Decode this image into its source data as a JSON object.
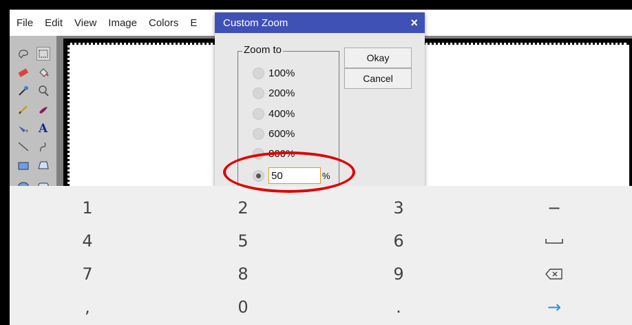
{
  "menu": [
    "File",
    "Edit",
    "View",
    "Image",
    "Colors",
    "E"
  ],
  "dialog": {
    "title": "Custom Zoom",
    "close": "×",
    "group_label": "Zoom to",
    "options": [
      "100%",
      "200%",
      "400%",
      "600%",
      "800%"
    ],
    "custom_value": "50",
    "custom_unit": "%",
    "ok_label": "Okay",
    "cancel_label": "Cancel"
  },
  "keyboard": {
    "rows": [
      [
        "1",
        "2",
        "3",
        "−"
      ],
      [
        "4",
        "5",
        "6",
        "␣"
      ],
      [
        "7",
        "8",
        "9",
        "⌫"
      ],
      [
        ",",
        "0",
        ".",
        "→"
      ]
    ]
  },
  "colors": {
    "title_bar": "#3f51b5",
    "highlight": "#e00000",
    "enter_key": "#2a8fd6"
  }
}
